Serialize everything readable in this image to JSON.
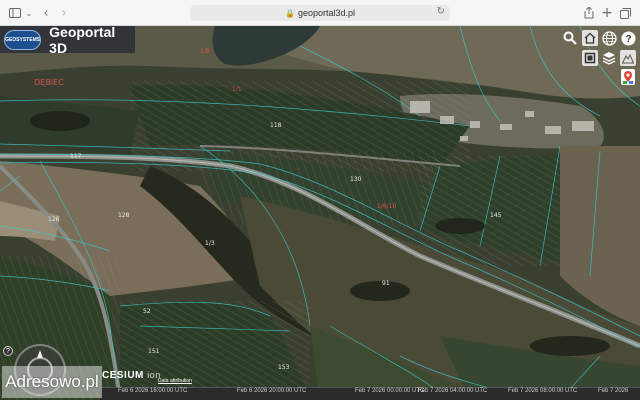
{
  "browser": {
    "url": "geoportal3d.pl",
    "toolbar_icons": [
      "sidebar-icon",
      "chevron-down-icon",
      "back-icon",
      "forward-icon",
      "share-icon",
      "new-tab-icon",
      "tabs-overview-icon"
    ]
  },
  "app": {
    "title": "Geoportal 3D",
    "logo_text": "GEOSYSTEMS"
  },
  "map_controls": {
    "icons": [
      "search-icon",
      "home-icon",
      "globe-icon",
      "help-icon",
      "base-layer-icon",
      "layers-icon",
      "terrain-icon",
      "google-maps-icon"
    ]
  },
  "map_labels": [
    {
      "text": "DĘBIEC",
      "color": "red"
    },
    {
      "text": "1/9",
      "color": "red"
    },
    {
      "text": "1/1",
      "color": "red"
    },
    {
      "text": "117",
      "color": "white"
    },
    {
      "text": "118",
      "color": "white"
    },
    {
      "text": "128",
      "color": "white"
    },
    {
      "text": "126",
      "color": "white"
    },
    {
      "text": "1/3",
      "color": "white"
    },
    {
      "text": "130",
      "color": "white"
    },
    {
      "text": "145",
      "color": "white"
    },
    {
      "text": "52",
      "color": "white"
    },
    {
      "text": "151",
      "color": "white"
    },
    {
      "text": "153",
      "color": "white"
    },
    {
      "text": "91",
      "color": "white"
    },
    {
      "text": "1/6/10",
      "color": "red"
    }
  ],
  "footer": {
    "cesium_brand": "CESIUM",
    "cesium_suffix": "ion",
    "attribution": "Data attribution",
    "watermark": "Adresowo.pl",
    "timeline_ticks": [
      "Feb 6 2026 16:00:00 UTC",
      "Feb 6 2026 20:00:00 UTC",
      "Feb 7 2026 00:00:00 UTC",
      "Feb 7 2026 04:00:00 UTC",
      "Feb 7 2026 08:00:00 UTC",
      "Feb 7 2026"
    ]
  }
}
